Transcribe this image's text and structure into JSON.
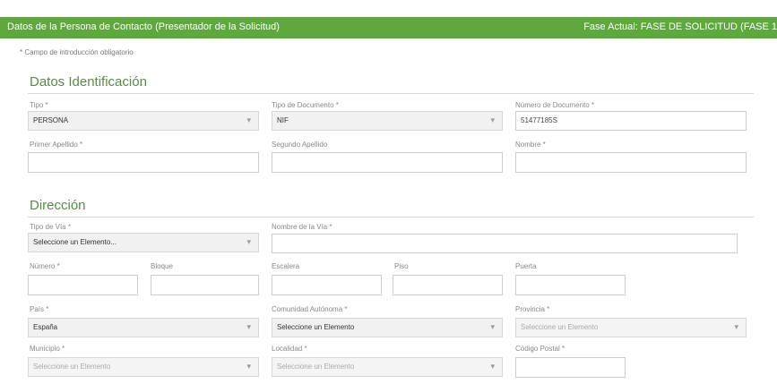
{
  "header": {
    "title": "Datos de la Persona de Contacto (Presentador de la Solicitud)",
    "phase": "Fase Actual: FASE DE SOLICITUD (FASE 1"
  },
  "required_note": "* Campo de introducción obligatorio",
  "identificacion": {
    "title": "Datos Identificación",
    "tipo": {
      "label": "Tipo *",
      "value": "PERSONA"
    },
    "tipo_documento": {
      "label": "Tipo de Documento *",
      "value": "NIF"
    },
    "numero_documento": {
      "label": "Número de Documento *",
      "value": "51477185S"
    },
    "primer_apellido": {
      "label": "Primer Apellido *",
      "value": ""
    },
    "segundo_apellido": {
      "label": "Segundo Apellido",
      "value": ""
    },
    "nombre": {
      "label": "Nombre *",
      "value": ""
    }
  },
  "direccion": {
    "title": "Dirección",
    "tipo_via": {
      "label": "Tipo de Vía *",
      "value": "Seleccione un Elemento..."
    },
    "nombre_via": {
      "label": "Nombre de la Vía *",
      "value": ""
    },
    "numero": {
      "label": "Número *",
      "value": ""
    },
    "bloque": {
      "label": "Bloque",
      "value": ""
    },
    "escalera": {
      "label": "Escalera",
      "value": ""
    },
    "piso": {
      "label": "Piso",
      "value": ""
    },
    "puerta": {
      "label": "Puerta",
      "value": ""
    },
    "pais": {
      "label": "País *",
      "value": "España"
    },
    "comunidad": {
      "label": "Comunidad Autónoma *",
      "value": "Seleccione un Elemento"
    },
    "provincia": {
      "label": "Provincia *",
      "value": "Seleccione un Elemento"
    },
    "municipio": {
      "label": "Municipio *",
      "value": "Seleccione un Elemento"
    },
    "localidad": {
      "label": "Localidad *",
      "value": "Seleccione un Elemento"
    },
    "codigo_postal": {
      "label": "Código Postal *",
      "value": ""
    }
  }
}
